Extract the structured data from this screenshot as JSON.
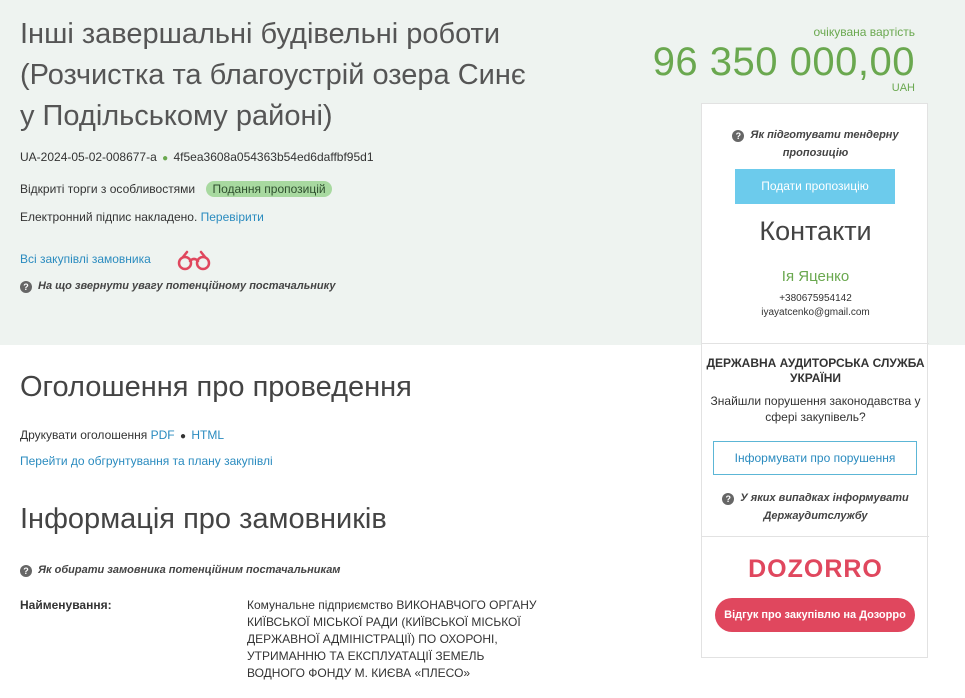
{
  "header": {
    "title_lines": [
      "Інші завершальні будівельні роботи",
      "(Розчистка та благоустрій озера Синє",
      "у Подільському районі)"
    ],
    "tender_id": "UA-2024-05-02-008677-a",
    "hash": "4f5ea3608a054363b54ed6daffbf95d1",
    "procedure_type": "Відкриті торги з особливостями",
    "status": "Подання пропозицій",
    "signature_text": "Електронний підпис накладено.",
    "verify_link": "Перевірити",
    "all_purchases_link": "Всі закупівлі замовника",
    "attention_hint": "На що звернути увагу потенційному постачальнику"
  },
  "price": {
    "label": "очікувана вартість",
    "value": "96 350 000,00",
    "currency": "UAH"
  },
  "sidebar": {
    "tender_hint": "Як підготувати тендерну пропозицію",
    "submit_button": "Подати пропозицію",
    "contacts_title": "Контакти",
    "contact_name": "Ія Яценко",
    "contact_phone": "+380675954142",
    "contact_email": "iyayatcenko@gmail.com",
    "audit_title": "ДЕРЖАВНА АУДИТОРСЬКА СЛУЖБА УКРАЇНИ",
    "audit_text": "Знайшли порушення законодавства у сфері закупівель?",
    "inform_button": "Інформувати про порушення",
    "audit_hint": "У яких випадках інформувати Держаудитслужбу",
    "dozorro_logo": "DOZORRO",
    "dozorro_button": "Відгук про закупівлю на Дозорро"
  },
  "announcement": {
    "title": "Оголошення про проведення",
    "print_label": "Друкувати оголошення",
    "pdf_link": "PDF",
    "html_link": "HTML",
    "plan_link": "Перейти до обгрунтування та плану закупівлі"
  },
  "customers": {
    "title": "Інформація про замовників",
    "hint": "Як обирати замовника потенційним постачальникам",
    "name_label": "Найменування:",
    "name_value": "Комунальне підприємство ВИКОНАВЧОГО ОРГАНУ КИЇВСЬКОЇ МІСЬКОЇ РАДИ (КИЇВСЬКОЇ МІСЬКОЇ ДЕРЖАВНОЇ АДМІНІСТРАЦІЇ) ПО ОХОРОНІ, УТРИМАННЮ ТА ЕКСПЛУАТАЦІЇ ЗЕМЕЛЬ ВОДНОГО ФОНДУ М. КИЄВА «ПЛЕСО»"
  },
  "colors": {
    "accent_green": "#6aa84f",
    "link_blue": "#2a8bbf",
    "dozorro_red": "#e0475e",
    "hero_bg": "#eef3f0"
  },
  "icons": {
    "question": "question-circle-icon",
    "binoculars": "binoculars-icon"
  }
}
